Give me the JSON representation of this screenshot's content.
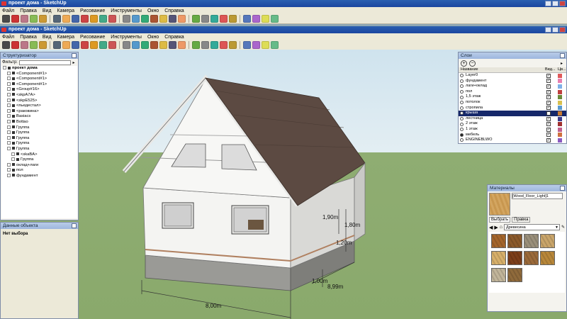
{
  "window1": {
    "title": "проект дома - SketchUp"
  },
  "window2": {
    "title": "проект дома - SketchUp"
  },
  "menu": [
    "Файл",
    "Правка",
    "Вид",
    "Камера",
    "Рисование",
    "Инструменты",
    "Окно",
    "Справка"
  ],
  "outliner": {
    "title": "Структуризатор",
    "filter_label": "Фильтр:",
    "filter_value": "",
    "items": [
      {
        "label": "проект дома",
        "level": 0
      },
      {
        "label": "<Component#1>",
        "level": 1
      },
      {
        "label": "<Component#1>",
        "level": 1
      },
      {
        "label": "<Component#1>",
        "level": 1
      },
      {
        "label": "<Group#16>",
        "level": 1
      },
      {
        "label": "<skpA7A>",
        "level": 1
      },
      {
        "label": "<skpE525>",
        "level": 1
      },
      {
        "label": "<пьедестал>",
        "level": 1
      },
      {
        "label": "<раковина>",
        "level": 1
      },
      {
        "label": "Basiacs",
        "level": 1
      },
      {
        "label": "Bottao",
        "level": 1
      },
      {
        "label": "Группа",
        "level": 1
      },
      {
        "label": "Группа",
        "level": 1
      },
      {
        "label": "Группа",
        "level": 1
      },
      {
        "label": "Группа",
        "level": 1
      },
      {
        "label": "Группа",
        "level": 1
      },
      {
        "label": "<skaBA>",
        "level": 2
      },
      {
        "label": "Группа",
        "level": 2
      },
      {
        "label": "оклад+лаги",
        "level": 1
      },
      {
        "label": "пол",
        "level": 1
      },
      {
        "label": "фундамент",
        "level": 1
      }
    ]
  },
  "entity_info": {
    "title": "Данные объекта",
    "value": "Нет выбора"
  },
  "layers": {
    "title": "Слои",
    "col_name": "Название",
    "col_visible": "Вид...",
    "col_color": "Цв...",
    "rows": [
      {
        "name": "Layer0",
        "color": "#e05a5a",
        "active": false,
        "selected": false
      },
      {
        "name": "фундамент",
        "color": "#e87fb0",
        "active": false,
        "selected": false
      },
      {
        "name": "лаги+оклад",
        "color": "#7fb0e8",
        "active": false,
        "selected": false
      },
      {
        "name": "пол",
        "color": "#c04040",
        "active": false,
        "selected": false
      },
      {
        "name": "1,5 этаж",
        "color": "#6a8a3a",
        "active": false,
        "selected": false
      },
      {
        "name": "потолок",
        "color": "#d8c050",
        "active": false,
        "selected": false
      },
      {
        "name": "стропила",
        "color": "#5a9ad0",
        "active": false,
        "selected": false
      },
      {
        "name": "крыша",
        "color": "#c87a30",
        "active": false,
        "selected": true
      },
      {
        "name": "лестница",
        "color": "#3a3a8a",
        "active": false,
        "selected": false
      },
      {
        "name": "2 этаж",
        "color": "#a03030",
        "active": false,
        "selected": false
      },
      {
        "name": "1 этаж",
        "color": "#c06090",
        "active": false,
        "selected": false
      },
      {
        "name": "мебель",
        "color": "#d07040",
        "active": true,
        "selected": false
      },
      {
        "name": "ENGINEBLWO",
        "color": "#8a5ac0",
        "active": false,
        "selected": false
      }
    ]
  },
  "materials": {
    "title": "Материалы",
    "current": "[Wood_Floor_Light]1",
    "tab_select": "Выбрать",
    "tab_edit": "Правка",
    "category": "Древесина",
    "swatches": [
      "#a4652b",
      "#8b5a2b",
      "#9a8f7a",
      "#c9a56a",
      "#d8b06a",
      "#7c3e1a",
      "#9b6a3a",
      "#b8873a",
      "#c1b59a",
      "#8f6a3b"
    ]
  },
  "dimensions": {
    "width": "8,00m",
    "depth": "8,99m",
    "foundation": "1,00m",
    "window_h1": "1,90m",
    "window_h2": "1,20m",
    "window_w": "1,80m"
  }
}
